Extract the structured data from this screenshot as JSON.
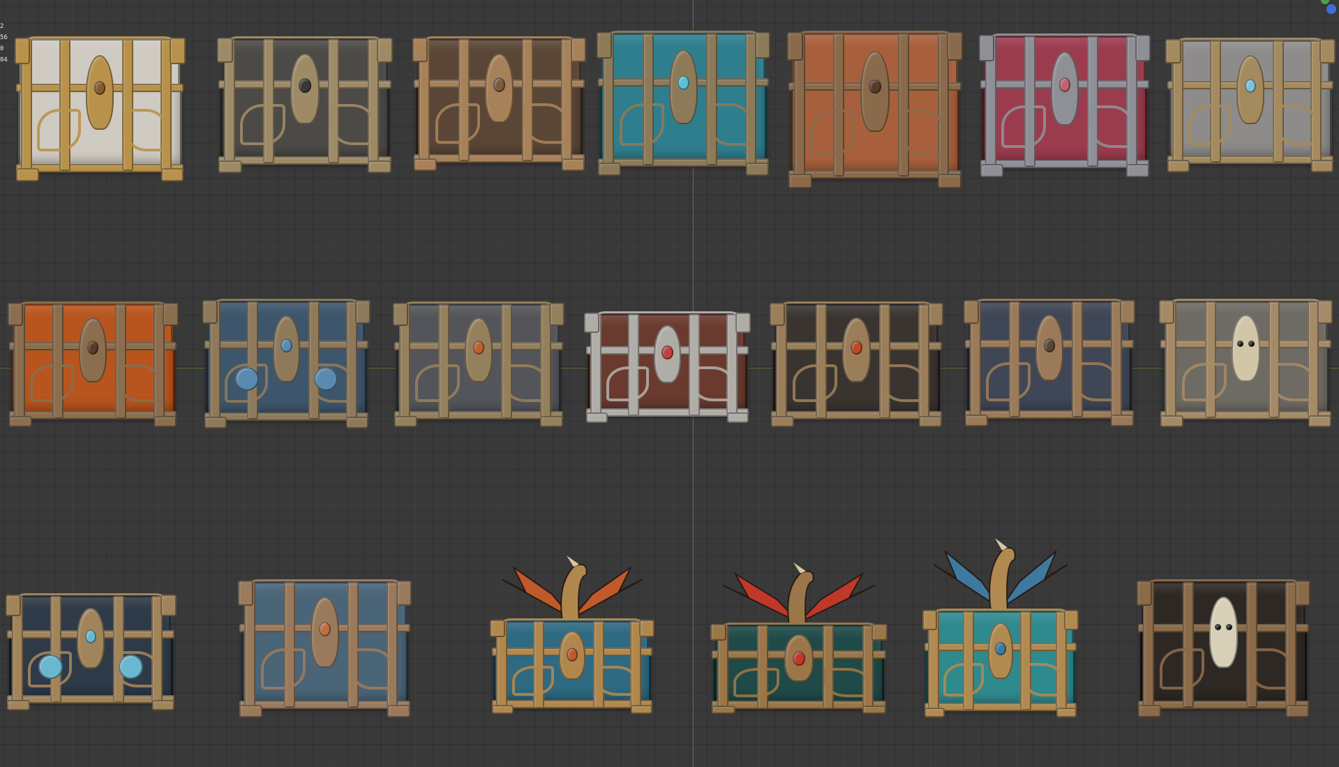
{
  "viewport": {
    "background": "#393939",
    "axis_y_color": "#4f6e92",
    "axis_x_color": "#5a7a3c"
  },
  "overlay_stats": [
    "2",
    "56",
    "0",
    "04"
  ],
  "gizmo": {
    "colors": [
      "#4aa54a",
      "#3d6fd6"
    ]
  },
  "chests": [
    {
      "name": "chest-white-gold",
      "row": 1,
      "body": "#cfcac2",
      "metal": "#b8924a",
      "accent": "#8a5a2a",
      "icon": "flame-crest-icon"
    },
    {
      "name": "chest-steel-ornate",
      "row": 1,
      "body": "#4c4a46",
      "metal": "#9f8a66",
      "accent": "#3a3733",
      "icon": "shield-crest-icon"
    },
    {
      "name": "chest-bronze-spade",
      "row": 1,
      "body": "#5a4636",
      "metal": "#a78158",
      "accent": "#7a5a3c",
      "icon": "spade-crest-icon"
    },
    {
      "name": "chest-teal-jewel",
      "row": 1,
      "body": "#2f7e8e",
      "metal": "#8d7a58",
      "accent": "#58c3d6",
      "icon": "gem-crest-icon"
    },
    {
      "name": "chest-copper-flame",
      "row": 1,
      "body": "#a8603c",
      "metal": "#8a6a4a",
      "accent": "#5a3a26",
      "icon": "flame-crest-icon"
    },
    {
      "name": "chest-crimson-steel",
      "row": 1,
      "body": "#9a3c4e",
      "metal": "#8f8f96",
      "accent": "#c06070",
      "icon": "lock-icon"
    },
    {
      "name": "chest-silver-dome",
      "row": 1,
      "body": "#8e8c8a",
      "metal": "#a48a5e",
      "accent": "#7ec2d8",
      "icon": "gem-crest-icon"
    },
    {
      "name": "chest-orange-wood",
      "row": 2,
      "body": "#b8541e",
      "metal": "#8a6e4e",
      "accent": "#5a3a24",
      "icon": "demon-crest-icon"
    },
    {
      "name": "chest-blue-swirl",
      "row": 2,
      "body": "#3e566c",
      "metal": "#8e7a5a",
      "accent": "#5a8ab0",
      "icon": "swirl-crest-icon"
    },
    {
      "name": "chest-grey-iron",
      "row": 2,
      "body": "#54555a",
      "metal": "#94805c",
      "accent": "#c0602a",
      "icon": "lock-icon"
    },
    {
      "name": "chest-brown-silver",
      "row": 2,
      "body": "#6a3a2e",
      "metal": "#b0aca6",
      "accent": "#c04040",
      "icon": "gem-crest-icon"
    },
    {
      "name": "chest-red-dark",
      "row": 2,
      "body": "#3a3430",
      "metal": "#9a7e5a",
      "accent": "#c04624",
      "icon": "heart-crest-icon"
    },
    {
      "name": "chest-slate-bronze",
      "row": 2,
      "body": "#3f4656",
      "metal": "#9a7a58",
      "accent": "#5a4636",
      "icon": "wing-crest-icon"
    },
    {
      "name": "chest-grey-skull",
      "row": 2,
      "body": "#6e6a64",
      "metal": "#a48a66",
      "accent": "#d2c6a8",
      "icon": "skull-icon"
    },
    {
      "name": "chest-blue-eyes",
      "row": 3,
      "body": "#2e3a48",
      "metal": "#a2845a",
      "accent": "#6ab8d0",
      "icon": "eye-crest-icon"
    },
    {
      "name": "chest-blue-wings",
      "row": 3,
      "body": "#4a6478",
      "metal": "#9a7a5c",
      "accent": "#c07040",
      "icon": "wing-crest-icon"
    },
    {
      "name": "chest-dragon-blue",
      "row": 3,
      "body": "#2e6a82",
      "metal": "#b0884e",
      "accent": "#c05a2a",
      "icon": "dragon-icon"
    },
    {
      "name": "chest-red-dragon",
      "row": 3,
      "body": "#1f4a48",
      "metal": "#9a7648",
      "accent": "#c0382a",
      "icon": "dragon-icon"
    },
    {
      "name": "chest-teal-dragon",
      "row": 3,
      "body": "#2f8a8e",
      "metal": "#b08a50",
      "accent": "#3e7aa0",
      "icon": "dragon-icon"
    },
    {
      "name": "chest-dark-skull",
      "row": 3,
      "body": "#2e2824",
      "metal": "#8a6a48",
      "accent": "#d8cfb8",
      "icon": "skull-icon"
    }
  ]
}
